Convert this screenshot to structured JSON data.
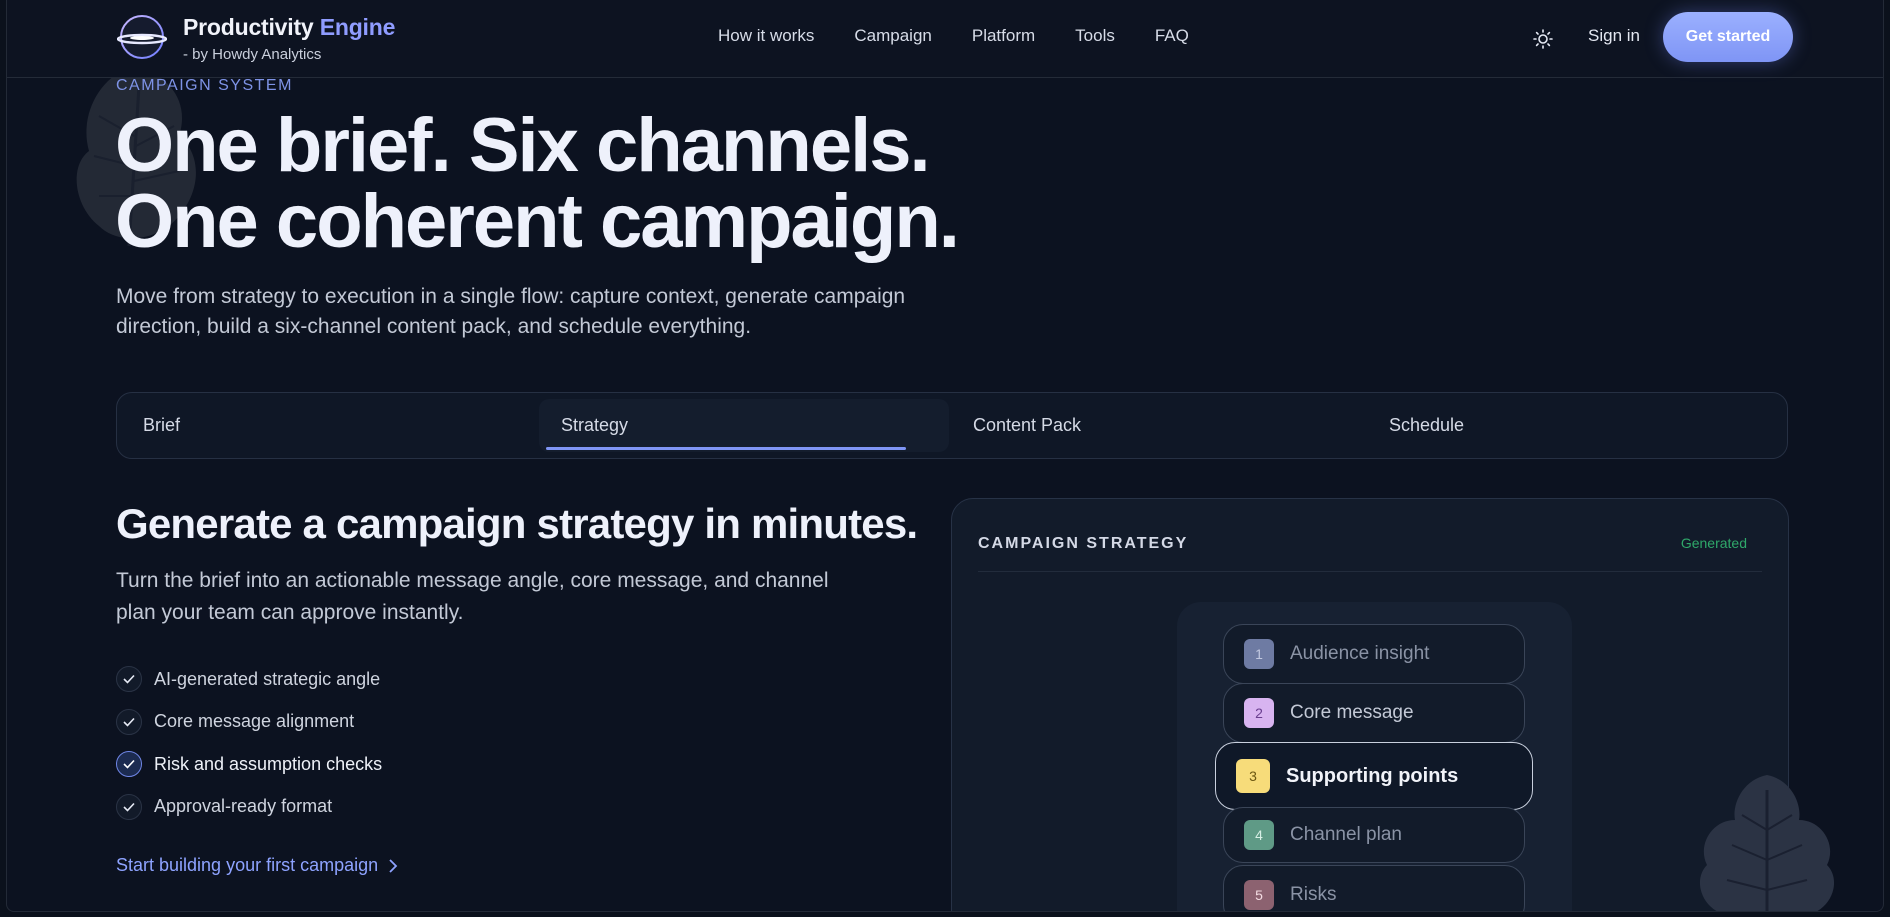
{
  "nav": {
    "brand_main": "Productivity",
    "brand_accent": "Engine",
    "brand_sub": "- by Howdy Analytics",
    "links": [
      "How it works",
      "Campaign",
      "Platform",
      "Tools",
      "FAQ"
    ],
    "theme_icon": "sun-icon",
    "sign_in": "Sign in",
    "cta": "Get started"
  },
  "hero": {
    "eyebrow": "CAMPAIGN SYSTEM",
    "title_line1": "One brief. Six channels.",
    "title_line2": "One coherent campaign.",
    "description": "Move from strategy to execution in a single flow: capture context, generate campaign direction, build a six-channel content pack, and schedule everything."
  },
  "tabs": [
    {
      "label": "Brief",
      "active": false
    },
    {
      "label": "Strategy",
      "active": true
    },
    {
      "label": "Content Pack",
      "active": false
    },
    {
      "label": "Schedule",
      "active": false
    }
  ],
  "feature": {
    "title": "Generate a campaign strategy in minutes.",
    "description": "Turn the brief into an actionable message angle, core message, and channel plan your team can approve instantly.",
    "checklist": [
      {
        "label": "AI-generated strategic angle",
        "active": false
      },
      {
        "label": "Core message alignment",
        "active": false
      },
      {
        "label": "Risk and assumption checks",
        "active": true
      },
      {
        "label": "Approval-ready format",
        "active": false
      }
    ],
    "link": "Start building your first campaign"
  },
  "card": {
    "label": "CAMPAIGN STRATEGY",
    "status": "Generated",
    "steps": [
      {
        "num": "1",
        "label": "Audience insight",
        "color": "#6e7ba3",
        "text_color": "#c2c9e0"
      },
      {
        "num": "2",
        "label": "Core message",
        "color": "#d8b4f0",
        "text_color": "#6a3e8f"
      },
      {
        "num": "3",
        "label": "Supporting points",
        "color": "#f7dc7a",
        "text_color": "#6b5712"
      },
      {
        "num": "4",
        "label": "Channel plan",
        "color": "#5f9a86",
        "text_color": "#d8efe6"
      },
      {
        "num": "5",
        "label": "Risks",
        "color": "#8c6270",
        "text_color": "#f3dce2"
      }
    ]
  },
  "colors": {
    "accent": "#8f9cff",
    "button": "#8fa4fb",
    "status_green": "#2fa86a",
    "background": "#0c1220"
  }
}
